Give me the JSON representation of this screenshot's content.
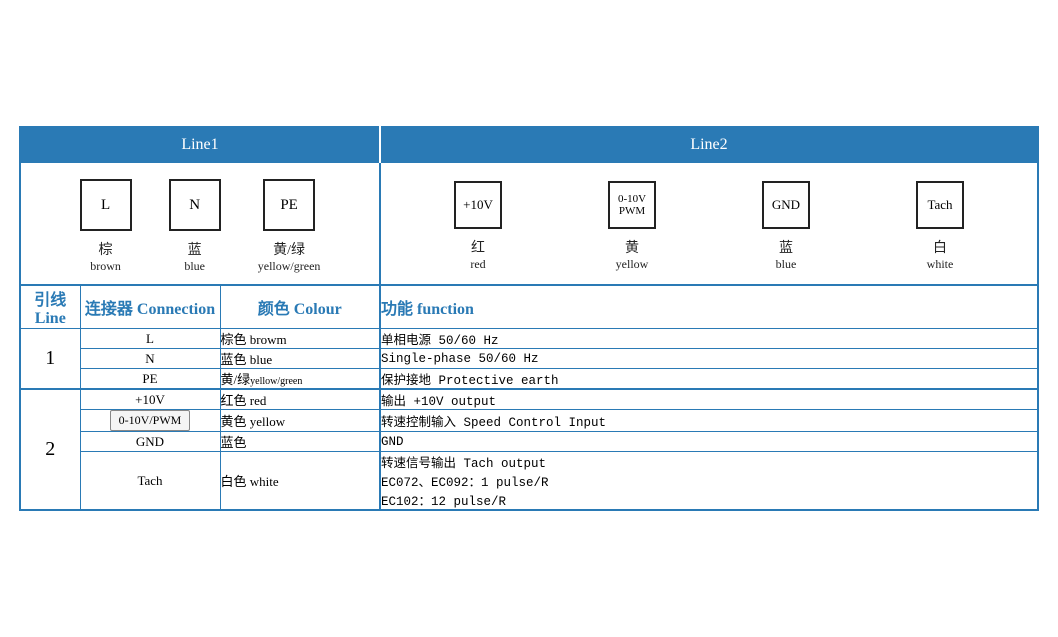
{
  "header": {
    "line1": "Line1",
    "line2": "Line2"
  },
  "line1_connectors": [
    {
      "label": "L",
      "cn": "棕",
      "en": "brown"
    },
    {
      "label": "N",
      "cn": "蓝",
      "en": "blue"
    },
    {
      "label": "PE",
      "cn": "黄/绿",
      "en": "yellow/green"
    }
  ],
  "line2_connectors": [
    {
      "label": "+10V",
      "cn": "红",
      "en": "red"
    },
    {
      "label": "0-10V\nPWM",
      "cn": "黄",
      "en": "yellow"
    },
    {
      "label": "GND",
      "cn": "蓝",
      "en": "blue"
    },
    {
      "label": "Tach",
      "cn": "白",
      "en": "white"
    }
  ],
  "table_headers": {
    "line": {
      "cn": "引线",
      "en": "Line"
    },
    "connection": {
      "cn": "连接器",
      "en": "Connection"
    },
    "colour": {
      "cn": "颜色",
      "en": "Colour"
    },
    "function": {
      "cn": "功能",
      "en": "function"
    }
  },
  "rows": [
    {
      "line": "1",
      "rowspan": 3,
      "entries": [
        {
          "connection": "L",
          "colour_cn": "棕色",
          "colour_en": "browm",
          "function": "单相电源 50/60 Hz"
        },
        {
          "connection": "N",
          "colour_cn": "蓝色",
          "colour_en": "blue",
          "function": "Single-phase 50/60 Hz"
        },
        {
          "connection": "PE",
          "colour_cn": "黄/绿",
          "colour_en": "yellow/green",
          "function": "保护接地 Protective earth"
        }
      ]
    },
    {
      "line": "2",
      "rowspan": 4,
      "entries": [
        {
          "connection": "+10V",
          "colour_cn": "红色",
          "colour_en": "red",
          "function": "输出 +10V output"
        },
        {
          "connection": "0-10V/PWM",
          "colour_cn": "黄色",
          "colour_en": "yellow",
          "function": "转速控制输入 Speed Control Input"
        },
        {
          "connection": "GND",
          "colour_cn": "蓝色",
          "colour_en": "",
          "function": "GND"
        },
        {
          "connection": "Tach",
          "colour_cn": "白色",
          "colour_en": "white",
          "function": "转速信号输出 Tach output\nEC072、EC092：1 pulse/R\nEC102：12 pulse/R"
        }
      ]
    }
  ]
}
